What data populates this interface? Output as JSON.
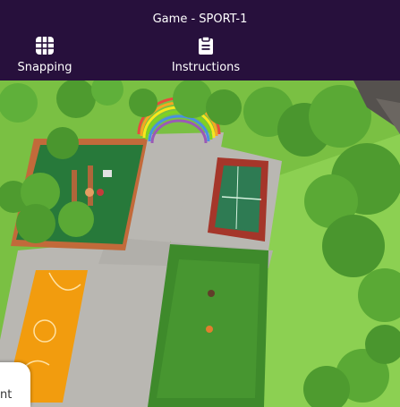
{
  "header": {
    "title": "Game - SPORT-1",
    "tools": {
      "snapping": {
        "label": "Snapping",
        "icon": "grid-icon"
      },
      "instructions": {
        "label": "Instructions",
        "icon": "clipboard-icon"
      }
    }
  },
  "scene": {
    "elements": [
      "rainbow",
      "playground",
      "tennis-court",
      "basketball-court",
      "grass-field",
      "trees",
      "cobblestone-path"
    ],
    "colors": {
      "header_bg": "#27103c",
      "grass": "#7ac043",
      "cobble": "#b9b7b2",
      "tennis_outer": "#a5362a",
      "tennis_inner": "#2e7b53",
      "basketball": "#f29c0e",
      "field": "#3e8a2b"
    }
  },
  "chat": {
    "text": "nt"
  }
}
